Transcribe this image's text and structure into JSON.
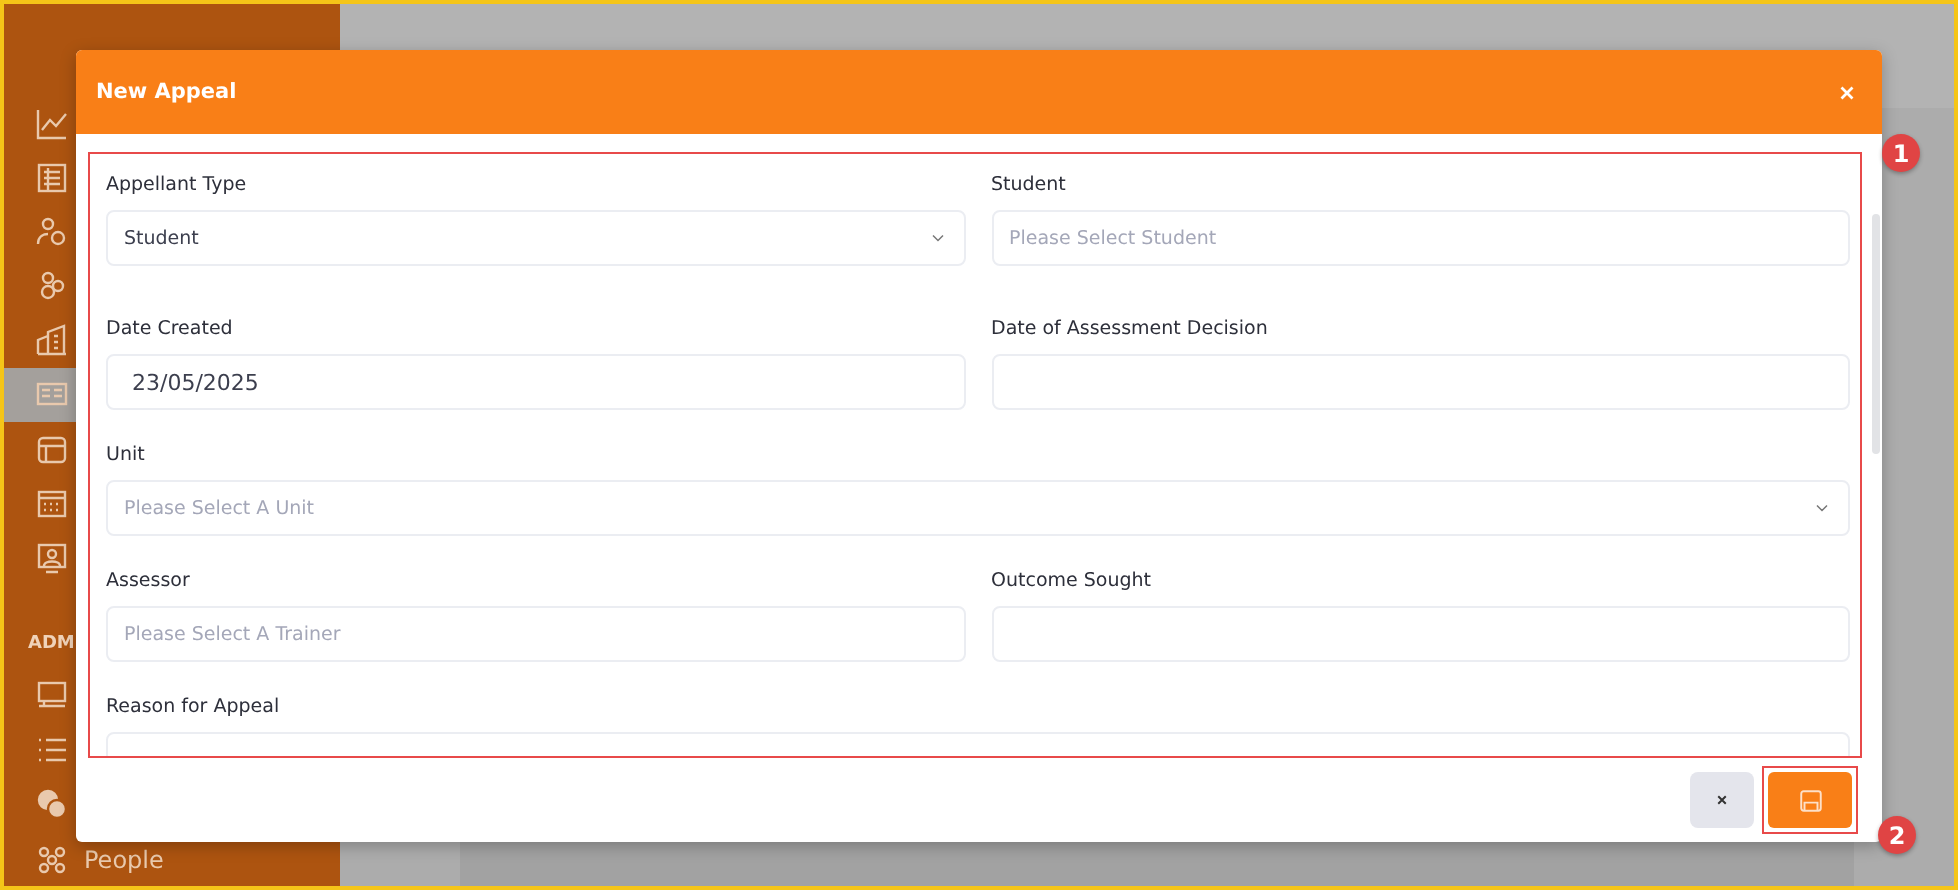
{
  "sidebar": {
    "nav_items": [
      {
        "selected": false
      },
      {
        "selected": false
      },
      {
        "selected": false
      },
      {
        "selected": false
      },
      {
        "selected": false
      },
      {
        "selected": true
      },
      {
        "selected": false
      },
      {
        "selected": false
      },
      {
        "selected": false
      }
    ],
    "section_label": "ADM",
    "admin_items": [
      {
        "selected": false
      },
      {
        "selected": false
      },
      {
        "selected": false
      }
    ],
    "people_item": {
      "label": "People"
    }
  },
  "dialog": {
    "title": "New Appeal",
    "rows": [
      [
        {
          "kind": "select",
          "label": "Appellant Type",
          "value": "Student"
        },
        {
          "kind": "input",
          "label": "Student",
          "placeholder": "Please Select Student"
        }
      ],
      [
        {
          "kind": "input",
          "label": "Date Created",
          "value": "23/05/2025"
        },
        {
          "kind": "input",
          "label": "Date of Assessment Decision"
        }
      ],
      [
        {
          "kind": "select",
          "label": "Unit",
          "placeholder": "Please Select A Unit"
        }
      ],
      [
        {
          "kind": "input",
          "label": "Assessor",
          "placeholder": "Please Select A Trainer"
        },
        {
          "kind": "input",
          "label": "Outcome Sought"
        }
      ],
      [
        {
          "kind": "input",
          "label": "Reason for Appeal"
        }
      ]
    ]
  },
  "annotations": [
    {
      "label": "1"
    },
    {
      "label": "2"
    }
  ]
}
